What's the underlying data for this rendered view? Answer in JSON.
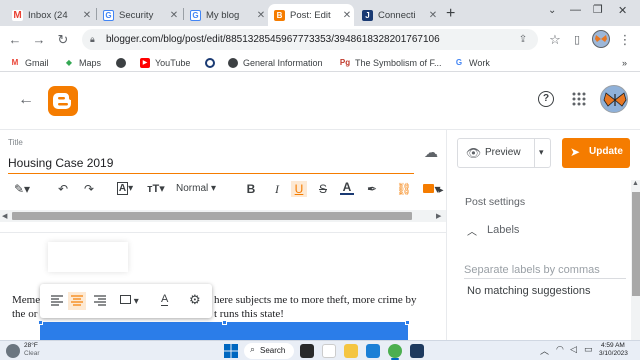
{
  "browser": {
    "tabs": [
      {
        "title": "Inbox (24",
        "icon": "gmail-icon",
        "color": "#ea4335",
        "active": false
      },
      {
        "title": "Security",
        "icon": "google-icon",
        "color": "#4285f4",
        "active": false
      },
      {
        "title": "My blog",
        "icon": "google-icon",
        "color": "#4285f4",
        "active": false
      },
      {
        "title": "Post: Edit",
        "icon": "blogger-icon",
        "color": "#f57c00",
        "active": true
      },
      {
        "title": "Connecti",
        "icon": "j-icon",
        "color": "#1a3a73",
        "active": false
      }
    ],
    "new_tab": "+",
    "url": "blogger.com/blog/post/edit/8851328545967773353/3948618328201767106",
    "bookmarks": [
      {
        "label": "Gmail",
        "icon": "gmail-icon"
      },
      {
        "label": "Maps",
        "icon": "maps-icon"
      },
      {
        "label": "",
        "icon": "globe-icon"
      },
      {
        "label": "YouTube",
        "icon": "youtube-icon"
      },
      {
        "label": "",
        "icon": "drive-icon"
      },
      {
        "label": "General Information",
        "icon": "globe-icon"
      },
      {
        "label": "The Symbolism of F...",
        "icon": "pg-icon"
      },
      {
        "label": "Work",
        "icon": "google-icon"
      }
    ],
    "bookmarks_more": "»"
  },
  "editor": {
    "title_label": "Title",
    "title_value": "Housing Case 2019",
    "font_name": "Normal",
    "body_line1_left": "Meme",
    "body_line1_right": "here subjects me to more theft, more crime by",
    "body_line2_left": "the or",
    "body_line2_right": "t runs this state!"
  },
  "sidebar": {
    "preview_label": "Preview",
    "update_label": "Update",
    "post_settings": "Post settings",
    "labels_heading": "Labels",
    "labels_placeholder": "Separate labels by commas",
    "no_match": "No matching suggestions"
  },
  "taskbar": {
    "weather_temp": "28°F",
    "weather_desc": "Clear",
    "search_label": "Search",
    "time": "4:59 AM",
    "date": "3/10/2023"
  },
  "colors": {
    "accent": "#f57c00",
    "blue": "#1a73e8",
    "selection": "#2b7de9"
  }
}
